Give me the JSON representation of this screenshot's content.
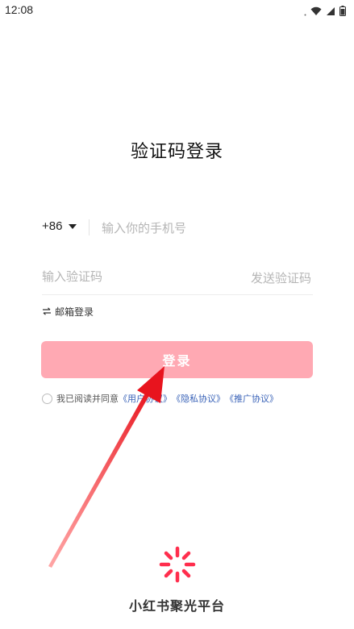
{
  "status_bar": {
    "time": "12:08",
    "icons": [
      "wifi-icon",
      "cellular-signal-icon",
      "battery-icon"
    ]
  },
  "login": {
    "title": "验证码登录",
    "country_code": "+86",
    "phone_placeholder": "输入你的手机号",
    "code_placeholder": "输入验证码",
    "send_code_label": "发送验证码",
    "email_login_label": "邮箱登录",
    "email_login_icon": "swap-arrows-icon",
    "submit_label": "登录",
    "agreement_prefix": "我已阅读并同意",
    "links": [
      "《用户协议》",
      "《隐私协议》",
      "《推广协议》"
    ]
  },
  "footer": {
    "brand_name": "小红书聚光平台",
    "logo_icon": "spinner-burst-icon"
  },
  "colors": {
    "login_button": "#ffa9b3",
    "link": "#3a63b8",
    "logo": "#ff2e4d",
    "annotation_arrow": "#e8141e"
  }
}
